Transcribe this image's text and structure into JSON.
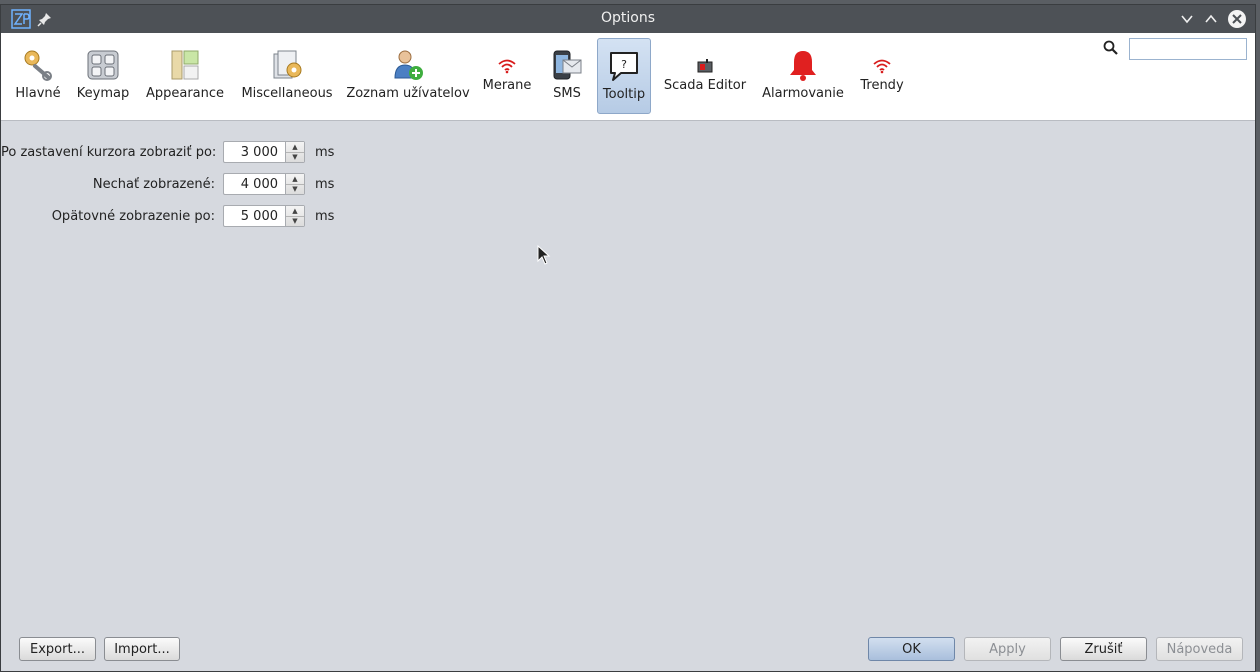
{
  "window": {
    "title": "Options"
  },
  "toolbar": {
    "categories": [
      {
        "id": "hlavne",
        "label": "Hlavné"
      },
      {
        "id": "keymap",
        "label": "Keymap"
      },
      {
        "id": "appearance",
        "label": "Appearance"
      },
      {
        "id": "misc",
        "label": "Miscellaneous"
      },
      {
        "id": "users",
        "label": "Zoznam užívatelov"
      },
      {
        "id": "merane",
        "label": "Merane"
      },
      {
        "id": "sms",
        "label": "SMS"
      },
      {
        "id": "tooltip",
        "label": "Tooltip"
      },
      {
        "id": "scada",
        "label": "Scada Editor"
      },
      {
        "id": "alarm",
        "label": "Alarmovanie"
      },
      {
        "id": "trendy",
        "label": "Trendy"
      }
    ],
    "selected": "Tooltip",
    "search": {
      "value": "",
      "placeholder": ""
    }
  },
  "tooltip_settings": {
    "rows": [
      {
        "label": "Po zastavení kurzora zobraziť po:",
        "value": "3 000",
        "unit": "ms"
      },
      {
        "label": "Nechať zobrazené:",
        "value": "4 000",
        "unit": "ms"
      },
      {
        "label": "Opätovné zobrazenie po:",
        "value": "5 000",
        "unit": "ms"
      }
    ]
  },
  "buttons": {
    "export": "Export...",
    "import": "Import...",
    "ok": "OK",
    "apply": "Apply",
    "cancel": "Zrušiť",
    "help": "Nápoveda"
  },
  "colors": {
    "accent": "#b6cbe5",
    "alarm_bell": "#e02020",
    "wifi_red": "#d81c1c"
  }
}
